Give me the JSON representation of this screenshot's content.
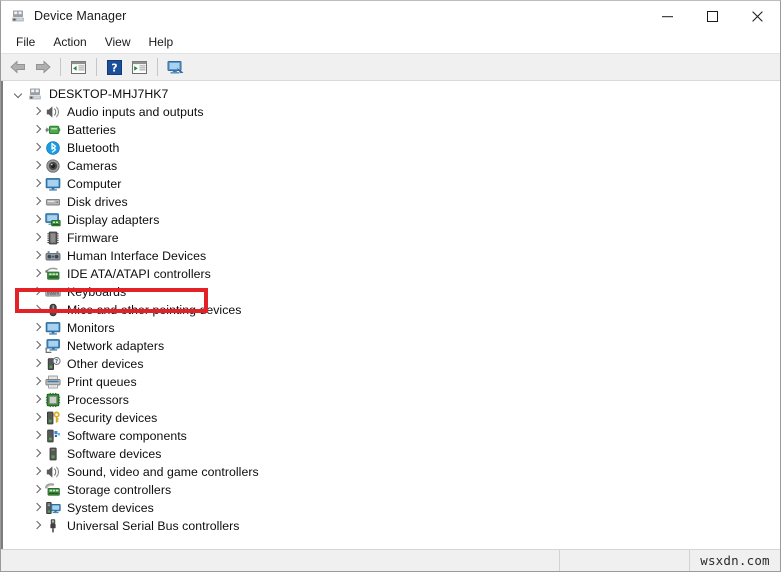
{
  "window": {
    "title": "Device Manager",
    "title_icon": "device-manager-icon",
    "controls": {
      "minimize": "─",
      "maximize": "□",
      "close": "✕"
    }
  },
  "menubar": {
    "items": [
      {
        "label": "File",
        "name": "menu-file"
      },
      {
        "label": "Action",
        "name": "menu-action"
      },
      {
        "label": "View",
        "name": "menu-view"
      },
      {
        "label": "Help",
        "name": "menu-help"
      }
    ]
  },
  "toolbar": {
    "buttons": [
      {
        "name": "back-button",
        "icon": "back-arrow-icon",
        "tooltip": "Back"
      },
      {
        "name": "forward-button",
        "icon": "forward-arrow-icon",
        "tooltip": "Forward"
      },
      {
        "name": "show-hide-console-tree-button",
        "icon": "console-tree-icon",
        "tooltip": "Show/Hide Console Tree"
      },
      {
        "name": "help-button",
        "icon": "help-question-icon",
        "tooltip": "Help"
      },
      {
        "name": "properties-button",
        "icon": "properties-icon",
        "tooltip": "Properties"
      },
      {
        "name": "scan-hardware-changes-button",
        "icon": "scan-monitor-icon",
        "tooltip": "Scan for hardware changes"
      }
    ]
  },
  "tree": {
    "root": {
      "label": "DESKTOP-MHJ7HK7",
      "icon": "computer-root-icon",
      "expanded": true
    },
    "items": [
      {
        "label": "Audio inputs and outputs",
        "icon": "speaker-icon",
        "name": "tree-item-audio-inputs-and-outputs"
      },
      {
        "label": "Batteries",
        "icon": "battery-icon",
        "name": "tree-item-batteries"
      },
      {
        "label": "Bluetooth",
        "icon": "bluetooth-icon",
        "name": "tree-item-bluetooth"
      },
      {
        "label": "Cameras",
        "icon": "camera-icon",
        "name": "tree-item-cameras"
      },
      {
        "label": "Computer",
        "icon": "monitor-icon",
        "name": "tree-item-computer"
      },
      {
        "label": "Disk drives",
        "icon": "disk-drive-icon",
        "name": "tree-item-disk-drives"
      },
      {
        "label": "Display adapters",
        "icon": "display-adapter-icon",
        "name": "tree-item-display-adapters",
        "highlighted": true
      },
      {
        "label": "Firmware",
        "icon": "firmware-chip-icon",
        "name": "tree-item-firmware"
      },
      {
        "label": "Human Interface Devices",
        "icon": "hid-icon",
        "name": "tree-item-human-interface-devices"
      },
      {
        "label": "IDE ATA/ATAPI controllers",
        "icon": "ide-controller-icon",
        "name": "tree-item-ide-ata-atapi-controllers"
      },
      {
        "label": "Keyboards",
        "icon": "keyboard-icon",
        "name": "tree-item-keyboards"
      },
      {
        "label": "Mice and other pointing devices",
        "icon": "mouse-icon",
        "name": "tree-item-mice-and-other-pointing-devices"
      },
      {
        "label": "Monitors",
        "icon": "monitor-icon",
        "name": "tree-item-monitors"
      },
      {
        "label": "Network adapters",
        "icon": "network-adapter-icon",
        "name": "tree-item-network-adapters"
      },
      {
        "label": "Other devices",
        "icon": "other-device-icon",
        "name": "tree-item-other-devices"
      },
      {
        "label": "Print queues",
        "icon": "printer-icon",
        "name": "tree-item-print-queues"
      },
      {
        "label": "Processors",
        "icon": "processor-icon",
        "name": "tree-item-processors"
      },
      {
        "label": "Security devices",
        "icon": "security-device-icon",
        "name": "tree-item-security-devices"
      },
      {
        "label": "Software components",
        "icon": "software-component-icon",
        "name": "tree-item-software-components"
      },
      {
        "label": "Software devices",
        "icon": "software-device-icon",
        "name": "tree-item-software-devices"
      },
      {
        "label": "Sound, video and game controllers",
        "icon": "speaker-icon",
        "name": "tree-item-sound-video-and-game-controllers"
      },
      {
        "label": "Storage controllers",
        "icon": "storage-controller-icon",
        "name": "tree-item-storage-controllers"
      },
      {
        "label": "System devices",
        "icon": "system-device-icon",
        "name": "tree-item-system-devices"
      },
      {
        "label": "Universal Serial Bus controllers",
        "icon": "usb-icon",
        "name": "tree-item-universal-serial-bus-controllers"
      }
    ]
  },
  "statusbar": {
    "status_text": "",
    "panel2_text": "",
    "watermark": "wsxdn.com"
  },
  "annotation": {
    "highlight_color": "#e32227",
    "highlight_target": "Display adapters"
  }
}
